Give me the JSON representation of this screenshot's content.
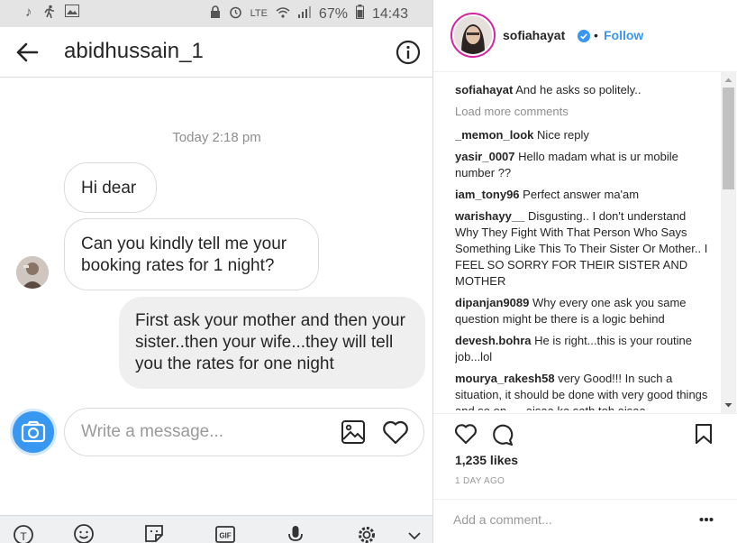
{
  "status_bar": {
    "battery": "67%",
    "time": "14:43",
    "network": "LTE"
  },
  "chat": {
    "title": "abidhussain_1",
    "timestamp": "Today 2:18 pm",
    "messages": [
      {
        "from": "other",
        "text": "Hi dear"
      },
      {
        "from": "other",
        "text": "Can you kindly tell me your booking rates for 1 night?"
      },
      {
        "from": "me",
        "text": "First ask your mother and then your sister..then your wife...they will tell you the rates for one night"
      }
    ],
    "input_placeholder": "Write a message..."
  },
  "keyboard_bar": {
    "icons": [
      "translate-icon",
      "emoji-icon",
      "sticker-icon",
      "gif-icon",
      "microphone-icon",
      "settings-icon",
      "collapse-icon"
    ],
    "gif_label": "GIF"
  },
  "post": {
    "username": "sofiahayat",
    "follow_dot": "•",
    "follow_label": "Follow",
    "load_more": "Load more comments",
    "caption": {
      "user": "sofiahayat",
      "text": "And he asks so politely.."
    },
    "comments": [
      {
        "user": "_memon_look",
        "text": "Nice reply"
      },
      {
        "user": "yasir_0007",
        "text": "Hello madam what is ur mobile number ??"
      },
      {
        "user": "iam_tony96",
        "text": "Perfect answer ma'am"
      },
      {
        "user": "warishayy__",
        "text": "Disgusting.. I don't understand Why They Fight With That Person Who Says Something Like This To Their Sister Or Mother.. I FEEL SO SORRY FOR THEIR SISTER AND MOTHER"
      },
      {
        "user": "dipanjan9089",
        "text": "Why every one ask you same question might be there is a logic behind"
      },
      {
        "user": "devesh.bohra",
        "text": "He is right...this is your routine job...lol"
      },
      {
        "user": "mourya_rakesh58",
        "text": "very Good!!! In such a situation, it should be done with very good things and so on .... aisaa ka sath toh aisaa"
      }
    ],
    "likes": "1,235 likes",
    "age": "1 DAY AGO",
    "add_comment_placeholder": "Add a comment...",
    "more_label": "•••"
  },
  "colors": {
    "accent": "#3897f0",
    "outgoing_bubble": "#efefef",
    "status_bar": "#e4e4e4",
    "story_ring": "#d6249f"
  }
}
